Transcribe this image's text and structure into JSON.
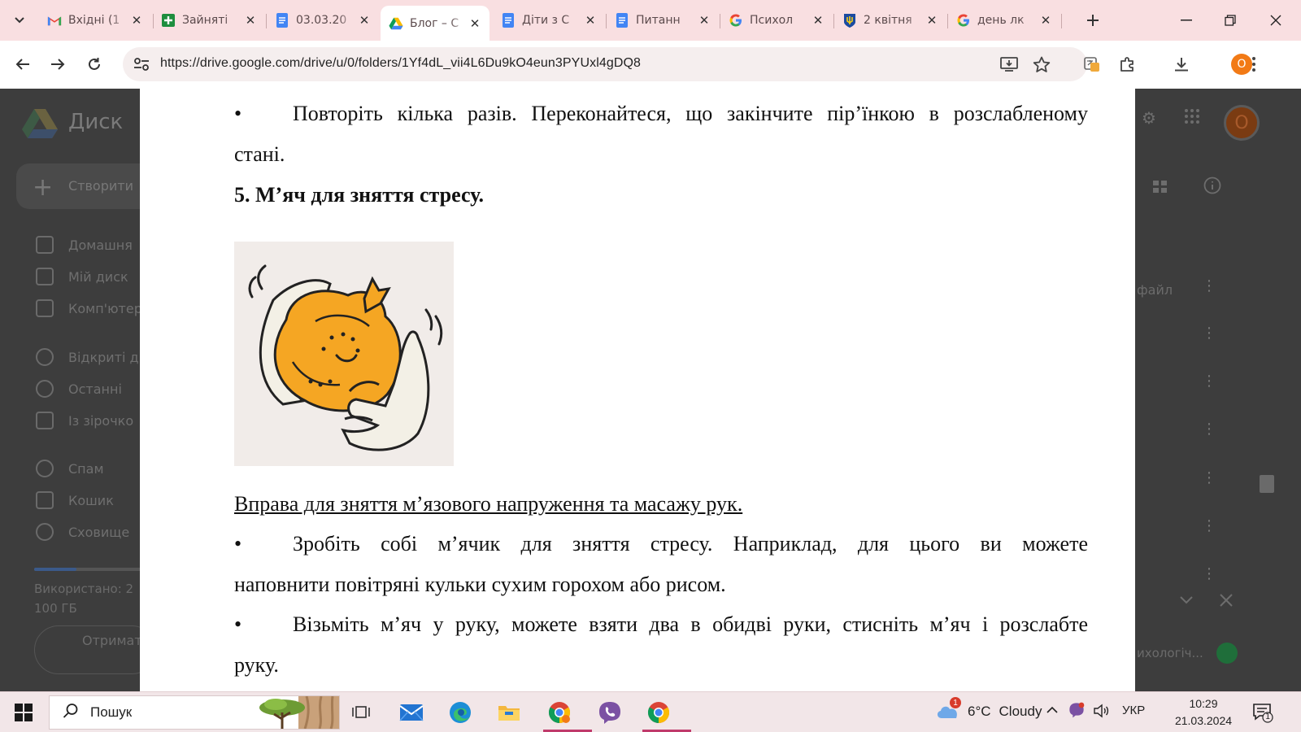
{
  "browser": {
    "tabs": [
      {
        "title": "Вхідні (1",
        "icon": "gmail-icon"
      },
      {
        "title": "Зайняті",
        "icon": "sheets-icon"
      },
      {
        "title": "03.03.20",
        "icon": "docs-icon"
      },
      {
        "title": "Блог – С",
        "icon": "drive-icon",
        "active": true
      },
      {
        "title": "Діти з С",
        "icon": "docs-icon"
      },
      {
        "title": "Питанн",
        "icon": "docs-icon"
      },
      {
        "title": "Психол",
        "icon": "google-icon"
      },
      {
        "title": "2 квітня",
        "icon": "trident-icon"
      },
      {
        "title": "день лк",
        "icon": "google-icon"
      }
    ],
    "url": "https://drive.google.com/drive/u/0/folders/1Yf4dL_vii4L6Du9kO4eun3PYUxl4gDQ8",
    "profile_letter": "O"
  },
  "drive": {
    "app_name": "Диск",
    "create_label": "Створити",
    "nav": [
      {
        "label": "Домашня"
      },
      {
        "label": "Мій диск"
      },
      {
        "label": "Комп'ютер"
      },
      {
        "label": "Відкриті д"
      },
      {
        "label": "Останні"
      },
      {
        "label": "Із зірочко"
      },
      {
        "label": "Спам"
      },
      {
        "label": "Кошик"
      },
      {
        "label": "Сховище"
      }
    ],
    "storage_line1": "Використано: 2",
    "storage_line2": "100 ГБ",
    "get_more": "Отримат",
    "file_label": "файл",
    "psych_label": "ихологіч...",
    "avatar_letter": "O"
  },
  "document": {
    "bullet": "•",
    "line1": "Повторіть кілька разів. Переконайтеся, що закінчите пір’їнкою в розслабленому",
    "line1_cont": "стані.",
    "heading5": "5. М’яч для зняття стресу.",
    "exercise_title": "Вправа для зняття м’язового напруження та масажу рук.",
    "b1_line1": "Зробіть собі м’ячик для зняття стресу. Наприклад, для цього ви можете",
    "b1_line2": "наповнити повітряні кульки сухим горохом або рисом.",
    "b2_line1": "Візьміть м’яч у руку, можете взяти два в обидві руки, стисніть м’яч і розслабте",
    "b2_line2": "руку."
  },
  "taskbar": {
    "search_placeholder": "Пошук",
    "weather_temp": "6°C",
    "weather_desc": "Cloudy",
    "weather_badge": "1",
    "language": "УКР",
    "time": "10:29",
    "date": "21.03.2024",
    "notif_count": "1"
  },
  "colors": {
    "tabstrip": "#f9dfe1",
    "drive_dim": "#3d3d3d",
    "profile_orange": "#f27a16",
    "ball_orange": "#f5a623"
  }
}
